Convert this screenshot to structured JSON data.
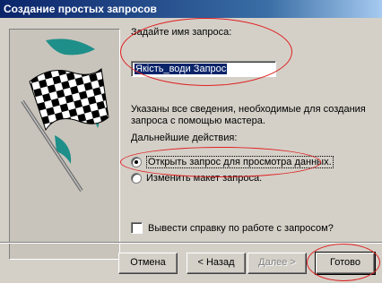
{
  "window": {
    "title": "Создание простых запросов"
  },
  "form": {
    "name_label": "Задайте имя запроса:",
    "name_value": "Якість_води Запрос",
    "info_line1": "Указаны все сведения, необходимые для создания",
    "info_line2": "запроса с помощью мастера.",
    "actions_label": "Дальнейшие действия:",
    "option_open": "Открыть запрос для просмотра данных.",
    "option_modify": "Изменить макет запроса.",
    "help_checkbox": "Вывести справку по работе с запросом?"
  },
  "buttons": {
    "cancel": "Отмена",
    "back": "< Назад",
    "next": "Далее >",
    "finish": "Готово"
  },
  "colors": {
    "titlebar": "#0a246a",
    "annotation": "#e02020",
    "flag_teal": "#1f8f8a"
  }
}
